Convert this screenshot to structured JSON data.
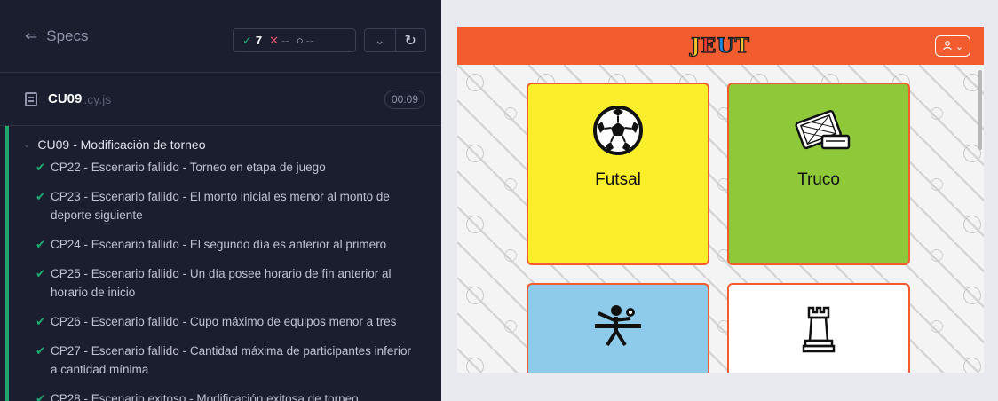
{
  "runner": {
    "specs_label": "Specs",
    "stats": {
      "passed": "7",
      "failed": "--",
      "pending": "--"
    },
    "spec": {
      "name": "CU09",
      "ext": ".cy.js",
      "duration": "00:09"
    },
    "suite_title": "CU09 - Modificación de torneo",
    "tests": [
      "CP22 - Escenario fallido - Torneo en etapa de juego",
      "CP23 - Escenario fallido - El monto inicial es menor al monto de deporte siguiente",
      "CP24 - Escenario fallido - El segundo día es anterior al primero",
      "CP25 - Escenario fallido - Un día posee horario de fin anterior al horario de inicio",
      "CP26 - Escenario fallido - Cupo máximo de equipos menor a tres",
      "CP27 - Escenario fallido - Cantidad máxima de participantes inferior a cantidad mínima",
      "CP28 - Escenario exitoso - Modificación exitosa de torneo"
    ]
  },
  "app": {
    "logo_letters": [
      "J",
      "E",
      "U",
      "T"
    ],
    "logo_colors": [
      "#f2c230",
      "#e53935",
      "#1e88e5",
      "#f2c230"
    ],
    "header_color": "#f25c2f",
    "cards": [
      {
        "label": "Futsal",
        "color": "#fbee2a",
        "icon": "soccer-ball-icon"
      },
      {
        "label": "Truco",
        "color": "#8fc93a",
        "icon": "playing-cards-icon"
      },
      {
        "label": "",
        "color": "#8ecbea",
        "icon": "ping-pong-icon"
      },
      {
        "label": "",
        "color": "#ffffff",
        "icon": "chess-rook-icon"
      }
    ]
  }
}
